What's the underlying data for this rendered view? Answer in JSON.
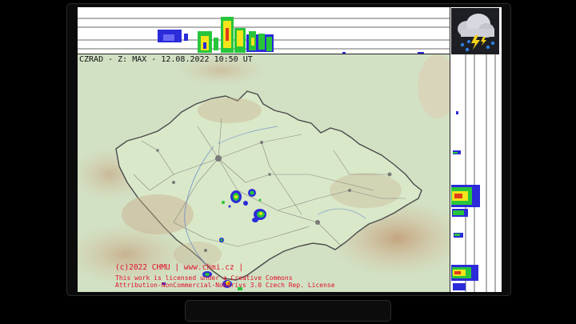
{
  "radar": {
    "timestamp": "CZRAD - Z: MAX - 12.08.2022 10:50 UT",
    "license_line1": "(c)2022 CHMU | www.chmi.cz |",
    "license_line2": "This work is licensed under a Creative Commons",
    "license_line3": "Attribution-NonCommercial-NoDerivs 3.0 Czech Rep. License"
  },
  "icons": {
    "weather_logo": "thunderstorm-cloud-icon"
  },
  "colors": {
    "frame": "#0b0b0b",
    "map_lowland": "#cfe3c2",
    "map_highland": "#c9ae8c",
    "border_line": "#4b4b4b",
    "echo_weak": "#2b2bd9",
    "echo_medium": "#27c63a",
    "echo_strong": "#f3e41b",
    "license_text": "#e0102a"
  }
}
